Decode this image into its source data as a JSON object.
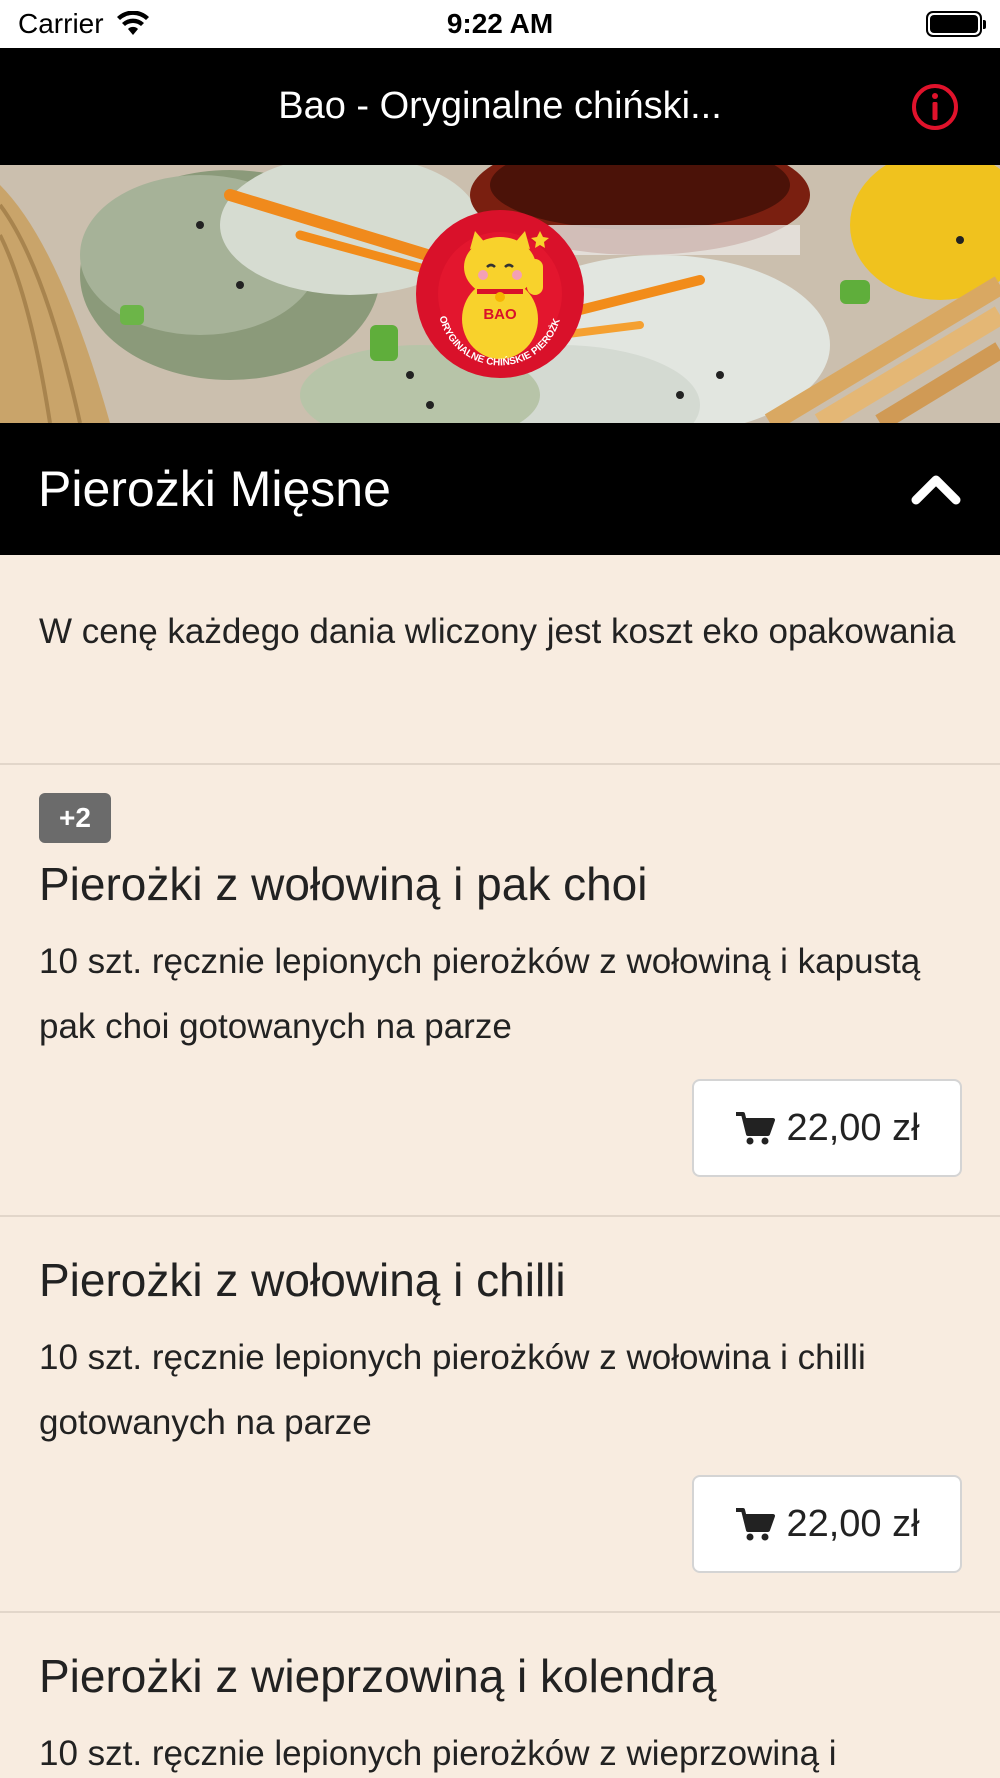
{
  "status_bar": {
    "carrier": "Carrier",
    "time": "9:22 AM"
  },
  "nav": {
    "title": "Bao - Oryginalne chiński..."
  },
  "hero": {
    "logo_text": "BAO",
    "logo_ring_text": "ORYGINALNE CHIŃSKIE PIEROŻKI"
  },
  "category": {
    "title": "Pierożki Mięsne"
  },
  "note": {
    "text": "W cenę każdego dania wliczony jest koszt eko opakowania"
  },
  "items": [
    {
      "badge": "+2",
      "title": "Pierożki z wołowiną i pak choi",
      "description": "10 szt. ręcznie lepionych pierożków z wołowiną i kapustą pak choi gotowanych na parze",
      "price": "22,00 zł"
    },
    {
      "title": "Pierożki z wołowiną i chilli",
      "description": "10 szt. ręcznie lepionych pierożków z wołowina i chilli gotowanych na parze",
      "price": "22,00 zł"
    },
    {
      "title": "Pierożki z wieprzowiną i kolendrą",
      "description": "10 szt. ręcznie lepionych pierożków z wieprzowiną i"
    }
  ],
  "colors": {
    "accent_red": "#e0122b",
    "header_bg": "#000000",
    "page_bg": "#f8ece0",
    "badge_bg": "#6b6b6b"
  },
  "icons": [
    "wifi-icon",
    "battery-icon",
    "info-icon",
    "chevron-up-icon",
    "cart-icon"
  ]
}
